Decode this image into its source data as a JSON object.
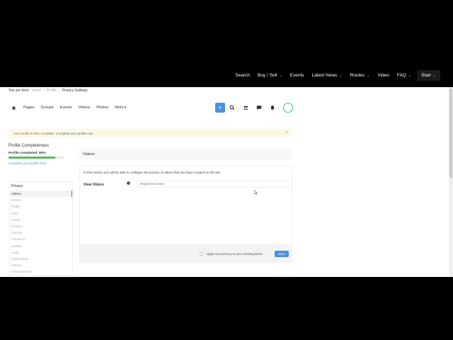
{
  "topnav": {
    "items": [
      {
        "label": "Search",
        "caret": false
      },
      {
        "label": "Buy / Sell",
        "caret": true
      },
      {
        "label": "Events",
        "caret": false
      },
      {
        "label": "Latest News",
        "caret": true
      },
      {
        "label": "Routes",
        "caret": true
      },
      {
        "label": "Video",
        "caret": false
      },
      {
        "label": "FAQ",
        "caret": true
      },
      {
        "label": "Start",
        "caret": true
      }
    ]
  },
  "breadcrumb": {
    "prefix": "You are here:",
    "items": [
      "Home",
      "Profile"
    ],
    "current": "Privacy Settings",
    "separator": "›"
  },
  "subnav": {
    "links": [
      "Pages",
      "Groups",
      "Events",
      "Videos",
      "Photos",
      "More"
    ],
    "plus_label": "+"
  },
  "alert": {
    "text": "Your profile is 85% complete.",
    "link": "Complete your profile now",
    "close": "×"
  },
  "profile_completeness": {
    "title": "Profile Completeness",
    "label": "Profile completed: 85%",
    "percent": 85,
    "link": "Complete your profile now!"
  },
  "privacy": {
    "heading": "Privacy",
    "items": [
      "Videos",
      "Stories",
      "Profile",
      "Polls",
      "Points",
      "Photos",
      "Friends",
      "Followers",
      "System",
      "Audio",
      "Applications",
      "Albums",
      "Achievements"
    ],
    "active_index": 0
  },
  "main": {
    "heading": "Videos",
    "intro": "In this section you will be able to configure the privacy of videos that you have created on the site.",
    "field_label": "View Videos",
    "select_value": "Registered Users",
    "apply_label": "Apply new privacy to your existing items",
    "save_label": "Save"
  },
  "colors": {
    "accent": "#4a90e2",
    "progress": "#5cb85c",
    "avatar_ring": "#2ecc71",
    "alert_bg": "#fcf8e3"
  }
}
